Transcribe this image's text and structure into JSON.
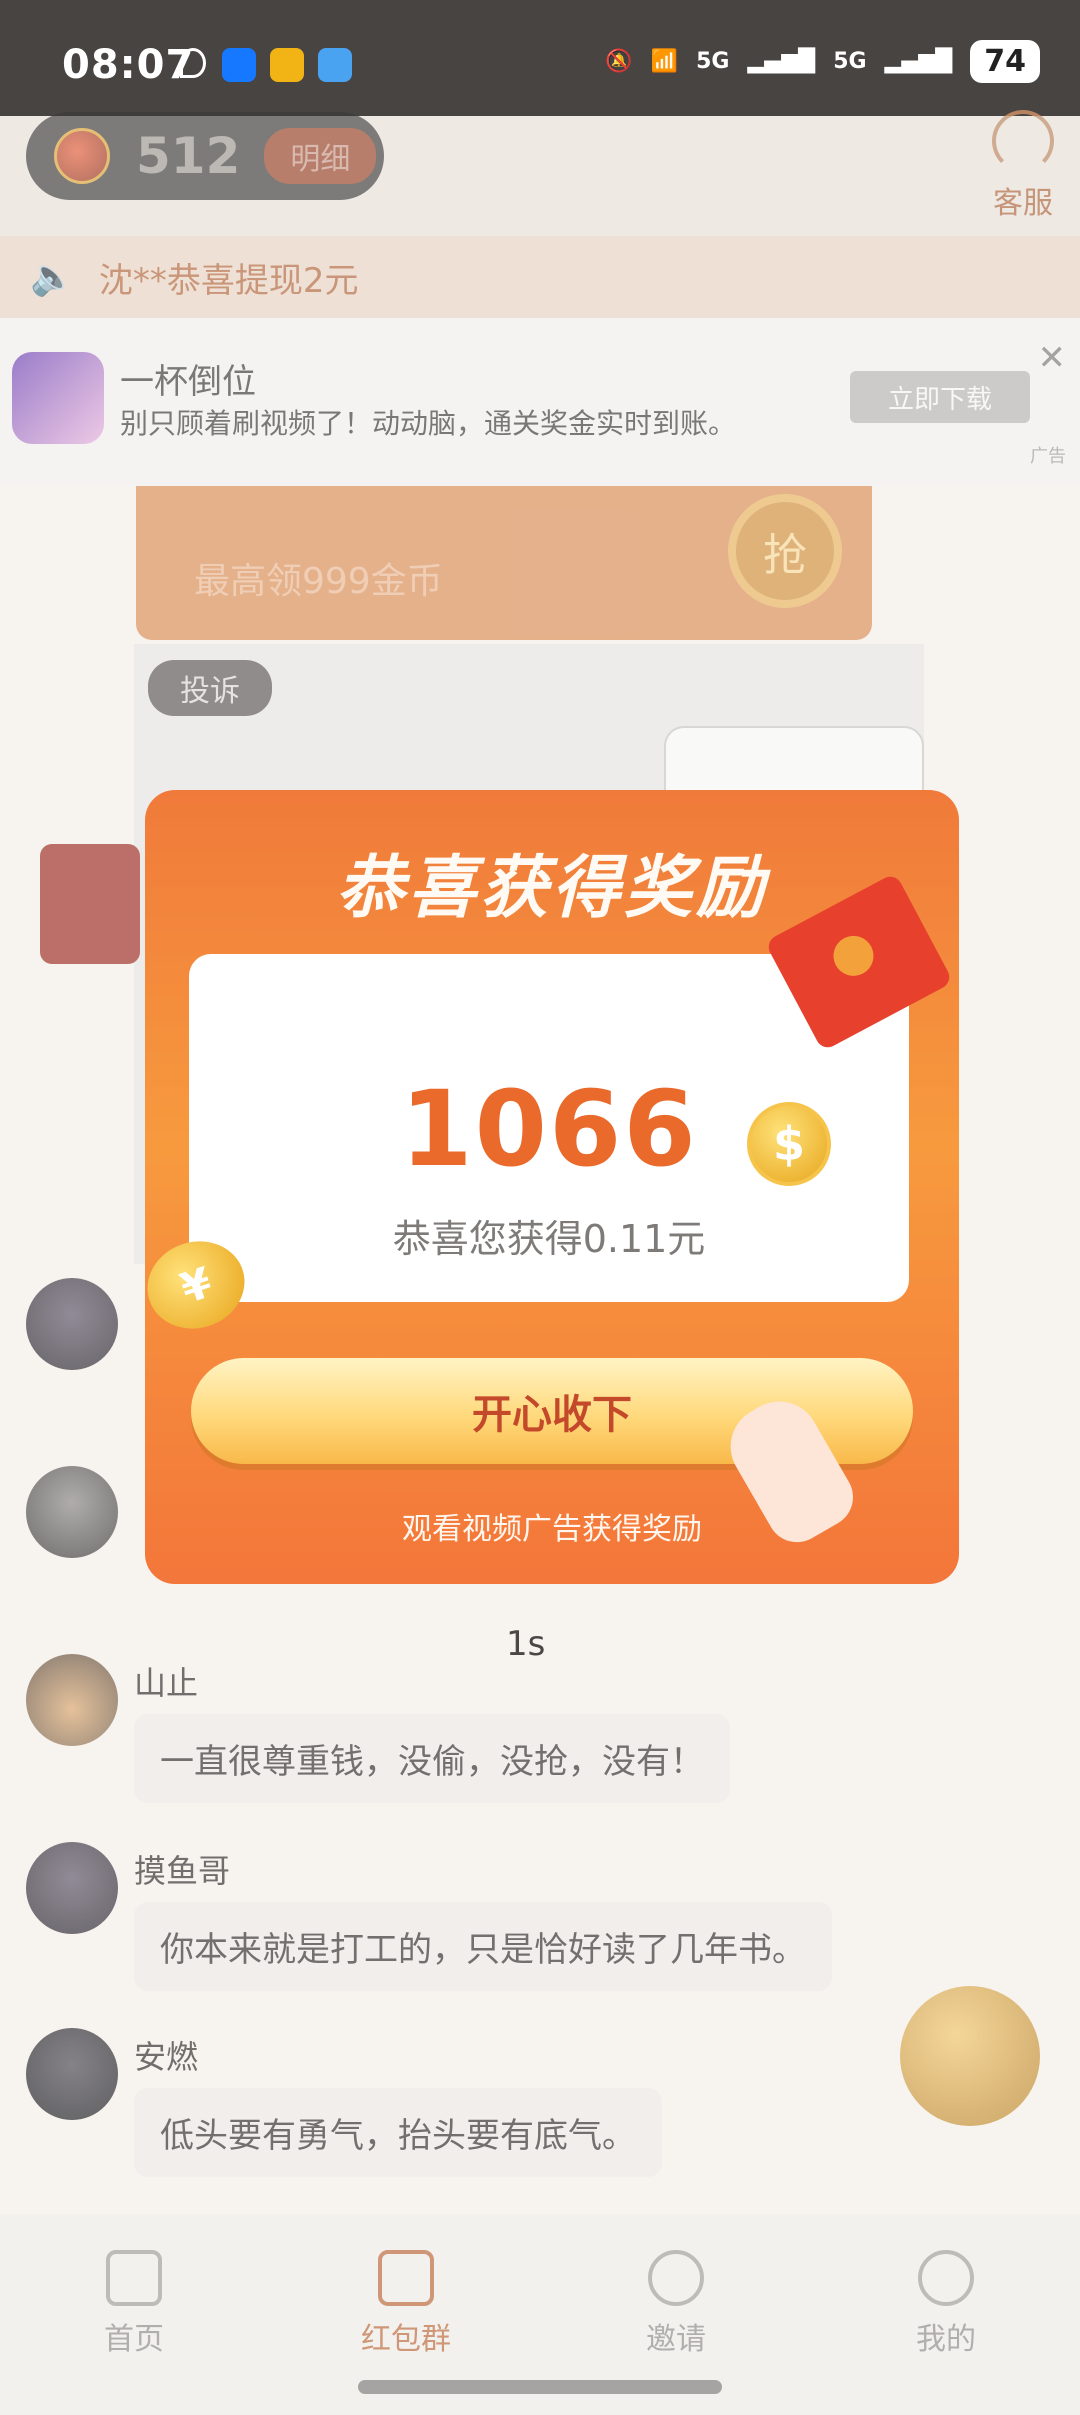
{
  "status_bar": {
    "time": "08:07",
    "network_1": "5G",
    "network_2": "5G",
    "battery": "74"
  },
  "header": {
    "coins": "512",
    "detail_button": "明细",
    "service_label": "客服"
  },
  "ticker": {
    "text": "沈**恭喜提现2元"
  },
  "ad": {
    "app_name": "一杯倒位",
    "description": "别只顾着刷视频了！动动脑，通关奖金实时到账。",
    "download_button": "立即下载",
    "ad_tag": "广告"
  },
  "promo": {
    "subtitle": "最高领999金币",
    "grab_label": "抢"
  },
  "image_card": {
    "complaint_button": "投诉"
  },
  "chat": {
    "messages": [
      {
        "user": "山止",
        "text": "一直很尊重钱，没偷，没抢，没有！"
      },
      {
        "user": "摸鱼哥",
        "text": "你本来就是打工的，只是恰好读了几年书。"
      },
      {
        "user": "安燃",
        "text": "低头要有勇气，抬头要有底气。"
      }
    ]
  },
  "modal": {
    "title": "恭喜获得奖励",
    "amount": "1066",
    "message": "恭喜您获得0.11元",
    "accept_button": "开心收下",
    "footer": "观看视频广告获得奖励",
    "dollar_glyph": "$",
    "yuan_glyph": "¥"
  },
  "countdown": "1s",
  "nav": {
    "items": [
      {
        "label": "首页",
        "active": false
      },
      {
        "label": "红包群",
        "active": true
      },
      {
        "label": "邀请",
        "active": false
      },
      {
        "label": "我的",
        "active": false
      }
    ]
  },
  "colors": {
    "accent": "#EA6A2C",
    "nav_active": "#B86637"
  }
}
